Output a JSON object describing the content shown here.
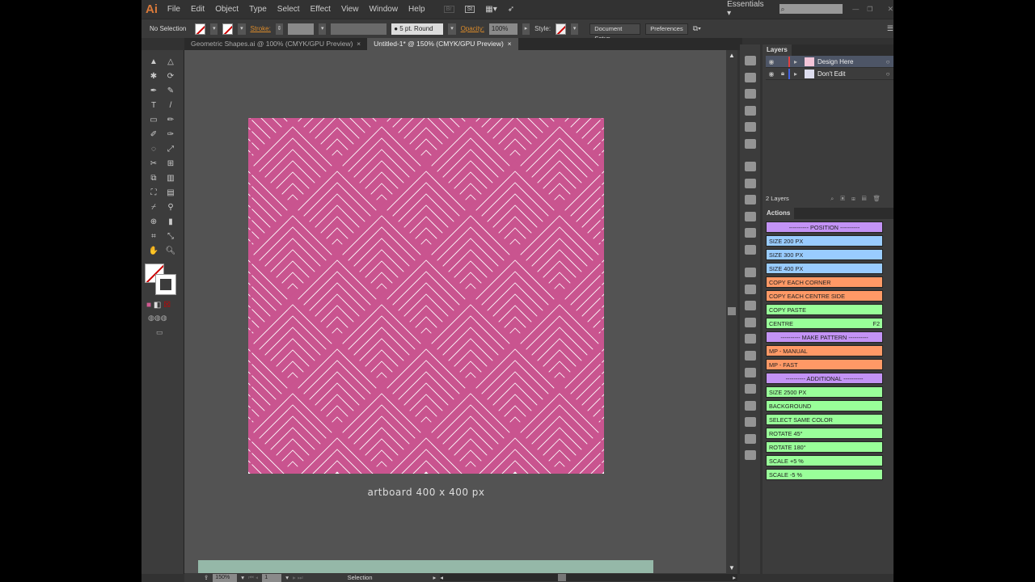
{
  "app": {
    "logo": "Ai"
  },
  "menu": [
    "File",
    "Edit",
    "Object",
    "Type",
    "Select",
    "Effect",
    "View",
    "Window",
    "Help"
  ],
  "menu_right": {
    "bridge": "Br",
    "stock": "St",
    "workspace": "Essentials",
    "workspace_arrow": "▾",
    "search_placeholder": ""
  },
  "window_controls": {
    "minimize": "—",
    "restore": "❐",
    "close": "✕"
  },
  "control": {
    "selection": "No Selection",
    "stroke_label": "Stroke:",
    "brush": "5 pt. Round",
    "opacity_label": "Opacity:",
    "opacity": "100%",
    "style_label": "Style:",
    "document_setup": "Document Setup",
    "preferences": "Preferences"
  },
  "tabs": [
    {
      "label": "Geometric Shapes.ai @ 100% (CMYK/GPU Preview)",
      "close": "×"
    },
    {
      "label": "Untitled-1* @ 150% (CMYK/GPU Preview)",
      "close": "×"
    }
  ],
  "canvas": {
    "artboard_label": "artboard 400 x 400 px"
  },
  "colors": {
    "pattern_pink": "#c9548f",
    "pattern_white": "#ffffff",
    "canvas": "#535353",
    "green_bar": "#95b8a8"
  },
  "layers": {
    "title": "Layers",
    "items": [
      {
        "name": "Design Here",
        "color": "#e04040",
        "locked": false
      },
      {
        "name": "Don't Edit",
        "color": "#4060e0",
        "locked": true
      }
    ],
    "count": "2 Layers"
  },
  "actions": {
    "title": "Actions",
    "items": [
      {
        "label": "---------- POSITION ----------",
        "color": "pur"
      },
      {
        "label": "SIZE 200 PX",
        "color": "blu"
      },
      {
        "label": "SIZE 300 PX",
        "color": "blu"
      },
      {
        "label": "SIZE 400 PX",
        "color": "blu"
      },
      {
        "label": "COPY EACH CORNER",
        "color": "org"
      },
      {
        "label": "COPY EACH CENTRE SIDE",
        "color": "org"
      },
      {
        "label": "COPY PASTE",
        "color": "grn"
      },
      {
        "label": "CENTRE",
        "color": "grn",
        "key": "F2"
      },
      {
        "label": "---------- MAKE PATTERN ----------",
        "color": "pur"
      },
      {
        "label": "MP - MANUAL",
        "color": "org"
      },
      {
        "label": "MP - FAST",
        "color": "org"
      },
      {
        "label": "---------- ADDITIONAL ----------",
        "color": "pur"
      },
      {
        "label": "SIZE 2500 PX",
        "color": "grn"
      },
      {
        "label": "BACKGROUND",
        "color": "grn"
      },
      {
        "label": "SELECT SAME COLOR",
        "color": "grn"
      },
      {
        "label": "ROTATE 45°",
        "color": "grn"
      },
      {
        "label": "ROTATE 180°",
        "color": "grn"
      },
      {
        "label": "SCALE +5 %",
        "color": "grn"
      },
      {
        "label": "SCALE -5 %",
        "color": "grn"
      }
    ]
  },
  "status": {
    "zoom": "150%",
    "artboard": "1",
    "tool": "Selection"
  }
}
